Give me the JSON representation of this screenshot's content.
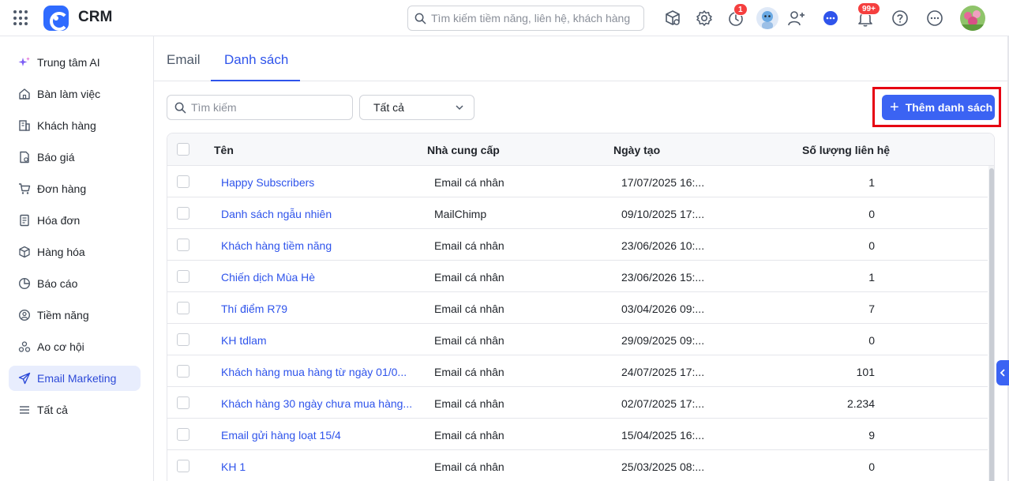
{
  "app": {
    "title": "CRM"
  },
  "header": {
    "search_placeholder": "Tìm kiếm tiềm năng, liên hệ, khách hàng",
    "timer_badge": "1",
    "notification_badge": "99+"
  },
  "sidebar": {
    "items": [
      {
        "label": "Trung tâm AI",
        "icon": "sparkle-icon"
      },
      {
        "label": "Bàn làm việc",
        "icon": "home-icon"
      },
      {
        "label": "Khách hàng",
        "icon": "building-icon"
      },
      {
        "label": "Báo giá",
        "icon": "quote-icon"
      },
      {
        "label": "Đơn hàng",
        "icon": "cart-icon"
      },
      {
        "label": "Hóa đơn",
        "icon": "invoice-icon"
      },
      {
        "label": "Hàng hóa",
        "icon": "box-icon"
      },
      {
        "label": "Báo cáo",
        "icon": "pie-chart-icon"
      },
      {
        "label": "Tiềm năng",
        "icon": "target-icon"
      },
      {
        "label": "Ao cơ hội",
        "icon": "opportunity-icon"
      },
      {
        "label": "Email Marketing",
        "icon": "send-icon",
        "active": true
      },
      {
        "label": "Tất cả",
        "icon": "menu-icon"
      }
    ]
  },
  "tabs": [
    {
      "label": "Email",
      "active": false
    },
    {
      "label": "Danh sách",
      "active": true
    }
  ],
  "toolbar": {
    "search_placeholder": "Tìm kiếm",
    "filter_value": "Tất cả",
    "add_button_label": "Thêm danh sách"
  },
  "table": {
    "columns": [
      "Tên",
      "Nhà cung cấp",
      "Ngày tạo",
      "Số lượng liên hệ"
    ],
    "rows": [
      {
        "name": "Happy Subscribers",
        "provider": "Email cá nhân",
        "created": "17/07/2025 16:...",
        "count": "1"
      },
      {
        "name": "Danh sách ngẫu nhiên",
        "provider": "MailChimp",
        "created": "09/10/2025 17:...",
        "count": "0"
      },
      {
        "name": "Khách hàng tiềm năng",
        "provider": "Email cá nhân",
        "created": "23/06/2026 10:...",
        "count": "0"
      },
      {
        "name": "Chiến dịch Mùa Hè",
        "provider": "Email cá nhân",
        "created": "23/06/2026 15:...",
        "count": "1"
      },
      {
        "name": "Thí điểm R79",
        "provider": "Email cá nhân",
        "created": "03/04/2026 09:...",
        "count": "7"
      },
      {
        "name": "KH tdlam",
        "provider": "Email cá nhân",
        "created": "29/09/2025 09:...",
        "count": "0"
      },
      {
        "name": "Khách hàng mua hàng từ ngày 01/0...",
        "provider": "Email cá nhân",
        "created": "24/07/2025 17:...",
        "count": "101"
      },
      {
        "name": "Khách hàng 30 ngày chưa mua hàng...",
        "provider": "Email cá nhân",
        "created": "02/07/2025 17:...",
        "count": "2.234"
      },
      {
        "name": "Email gửi hàng loạt 15/4",
        "provider": "Email cá nhân",
        "created": "15/04/2025 16:...",
        "count": "9"
      },
      {
        "name": "KH 1",
        "provider": "Email cá nhân",
        "created": "25/03/2025 08:...",
        "count": "0"
      }
    ]
  },
  "colors": {
    "accent": "#3b63f3",
    "link": "#2f54eb",
    "highlight_box": "#e60012",
    "badge": "#f53f3f"
  }
}
